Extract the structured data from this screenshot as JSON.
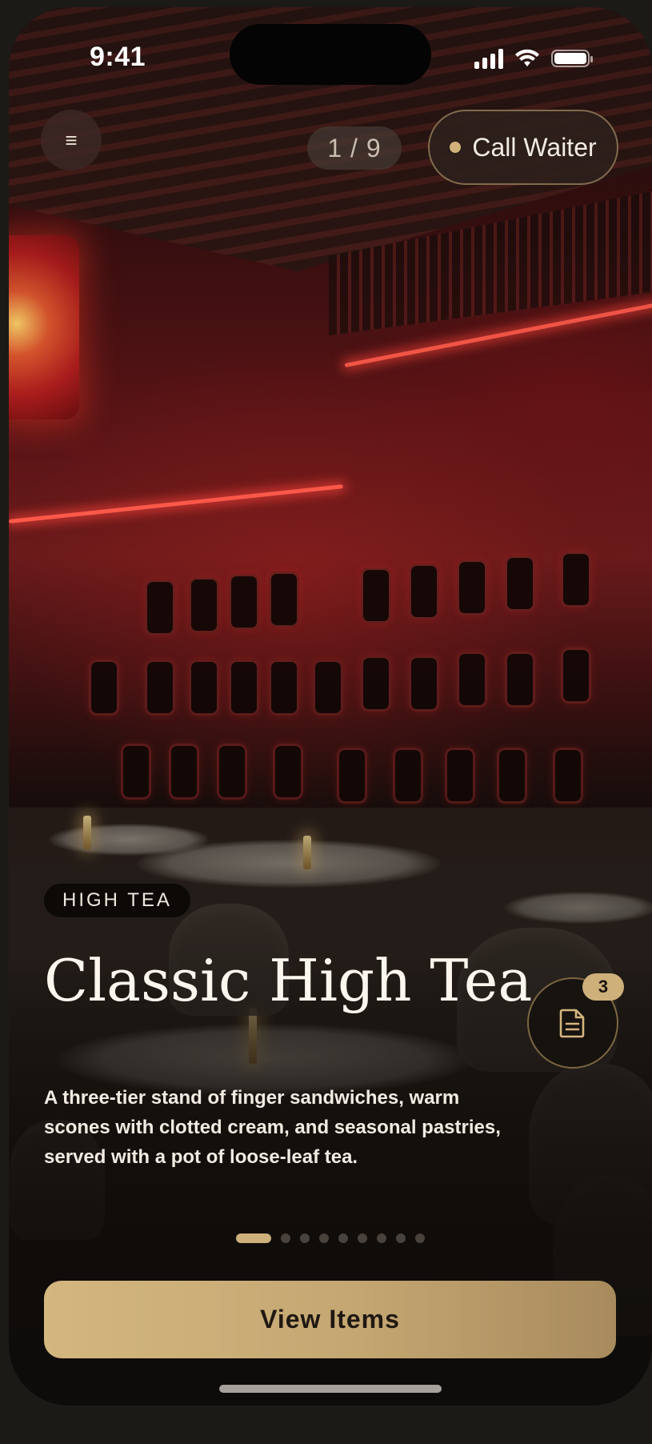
{
  "status_bar": {
    "time": "9:41"
  },
  "top_bar": {
    "menu_icon": "hamburger-icon",
    "menu_glyph": "≡",
    "page_counter": "1 / 9",
    "call_waiter_label": "Call Waiter"
  },
  "background": {
    "description_icon": "restaurant-photo"
  },
  "dish": {
    "category_tag": "HIGH TEA",
    "title": "Classic High Tea",
    "description": "A three-tier stand of finger sandwiches, warm scones with clotted cream, and seasonal pastries, served with a pot of loose-leaf tea."
  },
  "order": {
    "icon": "document-icon",
    "count": "3"
  },
  "pagination": {
    "total": 9,
    "current": 1
  },
  "cta": {
    "label": "View Items"
  },
  "colors": {
    "accent": "#cdb07a",
    "background": "#1c1a17"
  }
}
